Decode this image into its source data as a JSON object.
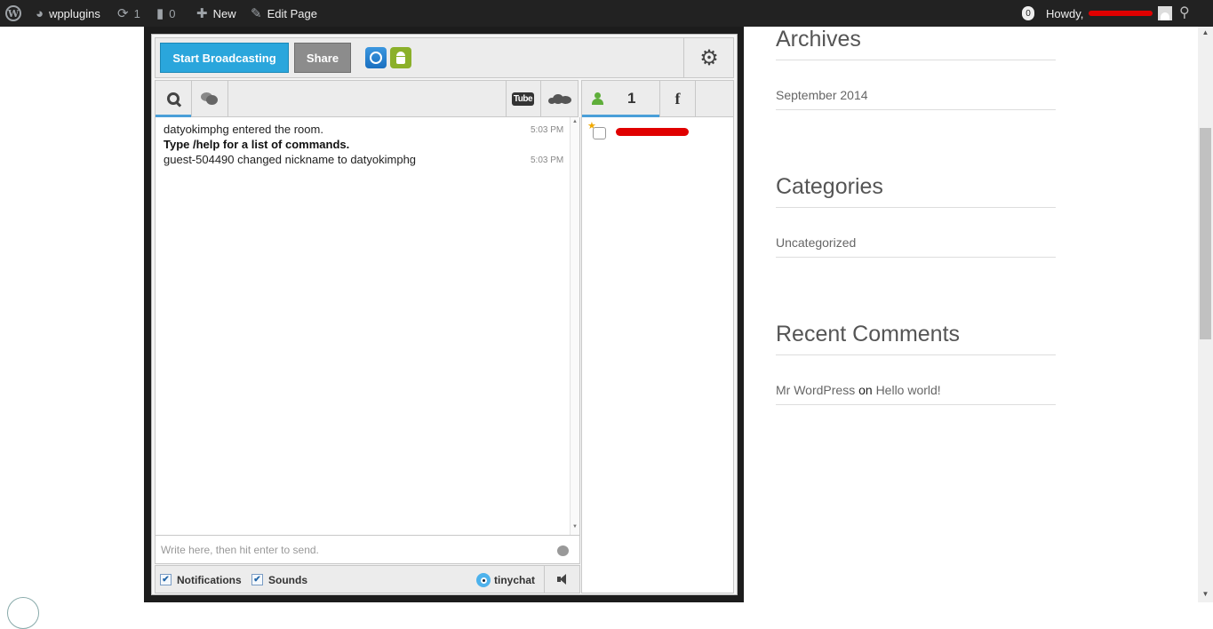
{
  "admin_bar": {
    "site_name": "wpplugins",
    "updates_count": "1",
    "comments_count": "0",
    "new_label": "New",
    "edit_label": "Edit Page",
    "notif_count": "0",
    "howdy": "Howdy,",
    "redacted_name": "",
    "icons": [
      "wordpress-logo-icon",
      "dashboard-icon",
      "refresh-icon",
      "comment-icon",
      "plus-icon",
      "pencil-icon",
      "avatar-icon",
      "search-icon"
    ]
  },
  "chat": {
    "broadcast_label": "Start Broadcasting",
    "share_label": "Share",
    "messages": [
      {
        "text": "datyokimphg entered the room.",
        "time": "5:03 PM",
        "bold": false
      },
      {
        "text": "Type /help for a list of commands.",
        "time": "",
        "bold": true
      },
      {
        "text": "guest-504490 changed nickname to datyokimphg",
        "time": "5:03 PM",
        "bold": false
      }
    ],
    "input_placeholder": "Write here, then hit enter to send.",
    "notifications_label": "Notifications",
    "sounds_label": "Sounds",
    "brand": "tinychat",
    "youtube_label": "Tube",
    "user_count": "1",
    "facebook_label": "f",
    "colors": {
      "broadcast": "#2aa6dc",
      "share": "#8c8c8c",
      "active_tab": "#4a9fd8",
      "user_green": "#5fae3a"
    }
  },
  "sidebar": {
    "archives_title": "Archives",
    "archives_item": "September 2014",
    "categories_title": "Categories",
    "categories_item": "Uncategorized",
    "recent_comments_title": "Recent Comments",
    "comment_author": "Mr WordPress",
    "comment_on": "on",
    "comment_post": "Hello world!"
  }
}
